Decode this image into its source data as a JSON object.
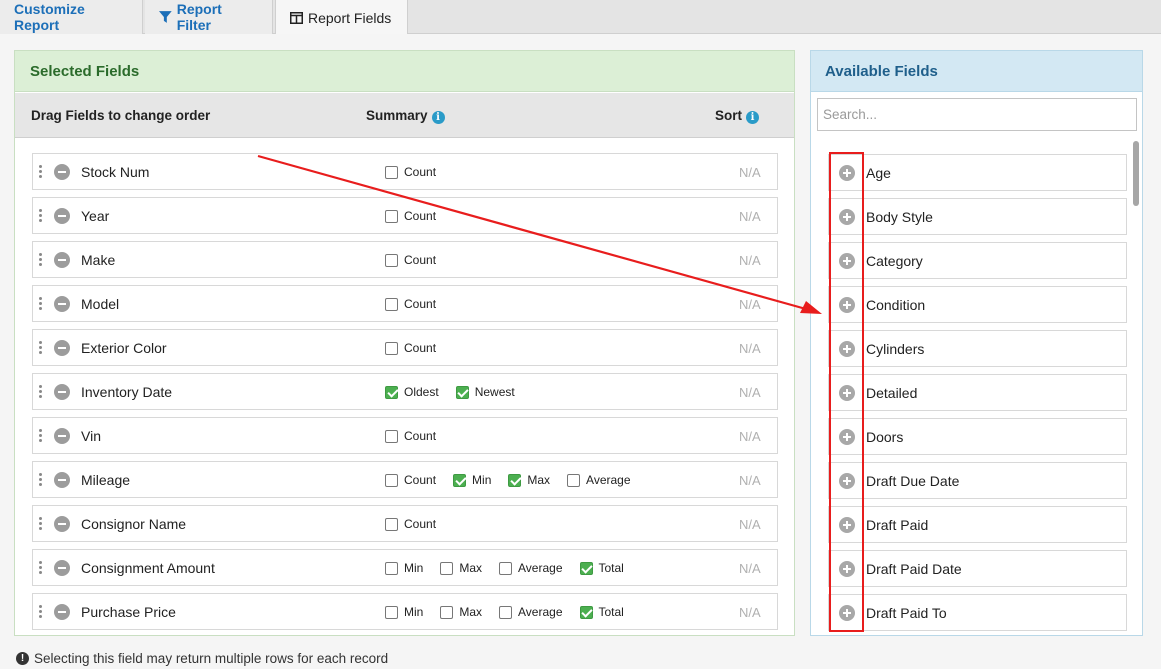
{
  "tabs": [
    {
      "label": "Customize Report"
    },
    {
      "label": "Report Filter"
    },
    {
      "label": "Report Fields"
    }
  ],
  "selected": {
    "title": "Selected Fields",
    "col_drag": "Drag Fields to change order",
    "col_summary": "Summary",
    "col_sort": "Sort",
    "rows": [
      {
        "label": "Stock Num",
        "sort": "N/A",
        "opts": [
          {
            "label": "Count",
            "checked": false
          }
        ]
      },
      {
        "label": "Year",
        "sort": "N/A",
        "opts": [
          {
            "label": "Count",
            "checked": false
          }
        ]
      },
      {
        "label": "Make",
        "sort": "N/A",
        "opts": [
          {
            "label": "Count",
            "checked": false
          }
        ]
      },
      {
        "label": "Model",
        "sort": "N/A",
        "opts": [
          {
            "label": "Count",
            "checked": false
          }
        ]
      },
      {
        "label": "Exterior Color",
        "sort": "N/A",
        "opts": [
          {
            "label": "Count",
            "checked": false
          }
        ]
      },
      {
        "label": "Inventory Date",
        "sort": "N/A",
        "opts": [
          {
            "label": "Oldest",
            "checked": true
          },
          {
            "label": "Newest",
            "checked": true
          }
        ]
      },
      {
        "label": "Vin",
        "sort": "N/A",
        "opts": [
          {
            "label": "Count",
            "checked": false
          }
        ]
      },
      {
        "label": "Mileage",
        "sort": "N/A",
        "opts": [
          {
            "label": "Count",
            "checked": false
          },
          {
            "label": "Min",
            "checked": true
          },
          {
            "label": "Max",
            "checked": true
          },
          {
            "label": "Average",
            "checked": false
          }
        ]
      },
      {
        "label": "Consignor Name",
        "sort": "N/A",
        "opts": [
          {
            "label": "Count",
            "checked": false
          }
        ]
      },
      {
        "label": "Consignment Amount",
        "sort": "N/A",
        "opts": [
          {
            "label": "Min",
            "checked": false
          },
          {
            "label": "Max",
            "checked": false
          },
          {
            "label": "Average",
            "checked": false
          },
          {
            "label": "Total",
            "checked": true
          }
        ]
      },
      {
        "label": "Purchase Price",
        "sort": "N/A",
        "opts": [
          {
            "label": "Min",
            "checked": false
          },
          {
            "label": "Max",
            "checked": false
          },
          {
            "label": "Average",
            "checked": false
          },
          {
            "label": "Total",
            "checked": true
          }
        ]
      }
    ]
  },
  "available": {
    "title": "Available Fields",
    "search_placeholder": "Search...",
    "items": [
      "Age",
      "Body Style",
      "Category",
      "Condition",
      "Cylinders",
      "Detailed",
      "Doors",
      "Draft Due Date",
      "Draft Paid",
      "Draft Paid Date",
      "Draft Paid To"
    ]
  },
  "footer_note": "Selecting this field may return multiple rows for each record",
  "icons": {
    "info": "info-icon",
    "filter": "filter-icon",
    "columns": "columns-icon",
    "remove": "minus-circle-icon",
    "add": "plus-circle-icon",
    "drag": "drag-handle-icon",
    "warning": "exclamation-icon"
  },
  "colors": {
    "accent": "#1c6fb8",
    "selected_header": "#dcefd6",
    "available_header": "#d3e8f3",
    "checkbox_checked": "#4caf50",
    "annotation": "#e81d1d"
  }
}
